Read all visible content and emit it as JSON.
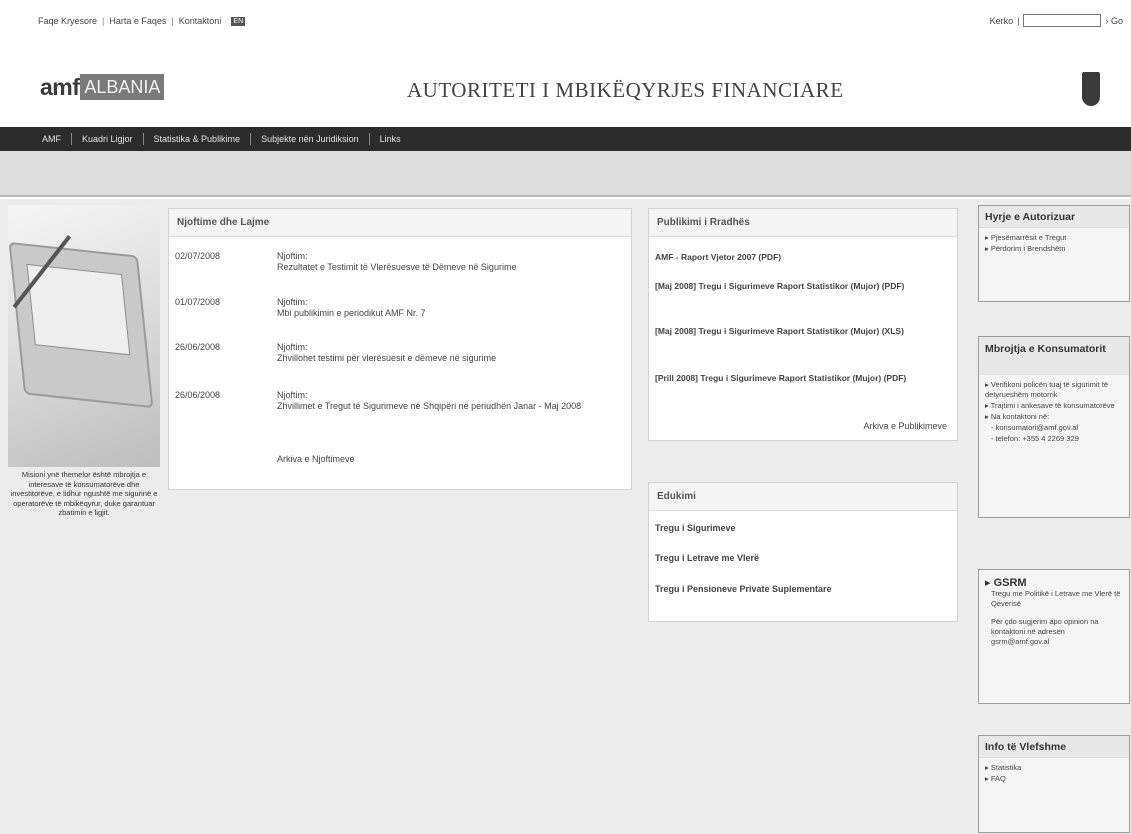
{
  "top": {
    "links": [
      "Faqe Kryesore",
      "Harta e Faqes",
      "Kontaktoni"
    ],
    "lang_badge": "EN",
    "search_label": "Kerko",
    "search_value": "",
    "go_label": "› Go"
  },
  "header": {
    "logo_amf": "amf",
    "logo_country": "ALBANIA",
    "title": "AUTORITETI I MBIKËQYRJES FINANCIARE"
  },
  "nav": {
    "items": [
      "AMF",
      "Kuadri Ligjor",
      "Statistika & Publikime",
      "Subjekte nën Juridiksion",
      "Links"
    ]
  },
  "mission": "Misioni ynë themelor është mbrojtja e interesave të konsumatorëve dhe investitorëve, e lidhur ngushtë me sigurinë e operatorëve të mbikëqyrur, duke garantuar zbatimin e ligjit.",
  "news": {
    "heading": "Njoftime dhe Lajme",
    "items": [
      {
        "date": "02/07/2008",
        "label": "Njoftim:",
        "text": "Rezultatet e Testimit të Vlerësuesve të Dëmeve në Sigurime"
      },
      {
        "date": "01/07/2008",
        "label": "Njoftim:",
        "text": "Mbi publikimin e periodikut AMF Nr. 7"
      },
      {
        "date": "26/06/2008",
        "label": "Njoftim:",
        "text": "Zhvillohet testimi për vlerësuesit e dëmeve në sigurime"
      },
      {
        "date": "26/06/2008",
        "label": "Njoftim:",
        "text": "Zhvillimet e Tregut të Sigurimeve në Shqipëri në periudhën Janar - Maj 2008"
      }
    ],
    "archive": "Arkiva e Njoftimeve"
  },
  "publications": {
    "heading": "Publikimi i Rradhës",
    "items": [
      "AMF - Raport Vjetor 2007 (PDF)",
      "[Maj 2008] Tregu i Sigurimeve Raport Statistikor (Mujor) (PDF)",
      "[Maj 2008] Tregu i Sigurimeve Raport Statistikor (Mujor) (XLS)",
      "[Prill 2008] Tregu i Sigurimeve Raport Statistikor (Mujor) (PDF)"
    ],
    "archive": "Arkiva e Publikimeve"
  },
  "education": {
    "heading": "Edukimi",
    "items": [
      "Tregu i Sigurimeve",
      "Tregu i Letrave me Vlerë",
      "Tregu i Pensioneve Private Suplementare"
    ]
  },
  "auth": {
    "heading": "Hyrje e Autorizuar",
    "items": [
      "Pjesëmarrësit e Tregut",
      "Përdorim i Brendshëm"
    ]
  },
  "protect": {
    "heading": "Mbrojtja e Konsumatorit",
    "items": [
      "Verifikoni policën tuaj të sigurimit të detyrueshëm motorrik",
      "Trajtimi i ankesave të konsumatorëve",
      "Na kontaktoni në:"
    ],
    "contact_email": "- konsumatori@amf.gov.al",
    "contact_phone": "- telefon: +355 4 2269 329"
  },
  "gsrm": {
    "title": "GSRM",
    "subtitle": "Tregu me Politikë i Letrave me Vlerë të Qeverisë",
    "note": "Për çdo sugjerim apo opinion na kontaktoni në adresën gsrm@amf.gov.al"
  },
  "info": {
    "heading": "Info të Vlefshme",
    "items": [
      "Statistika",
      "FAQ"
    ]
  }
}
